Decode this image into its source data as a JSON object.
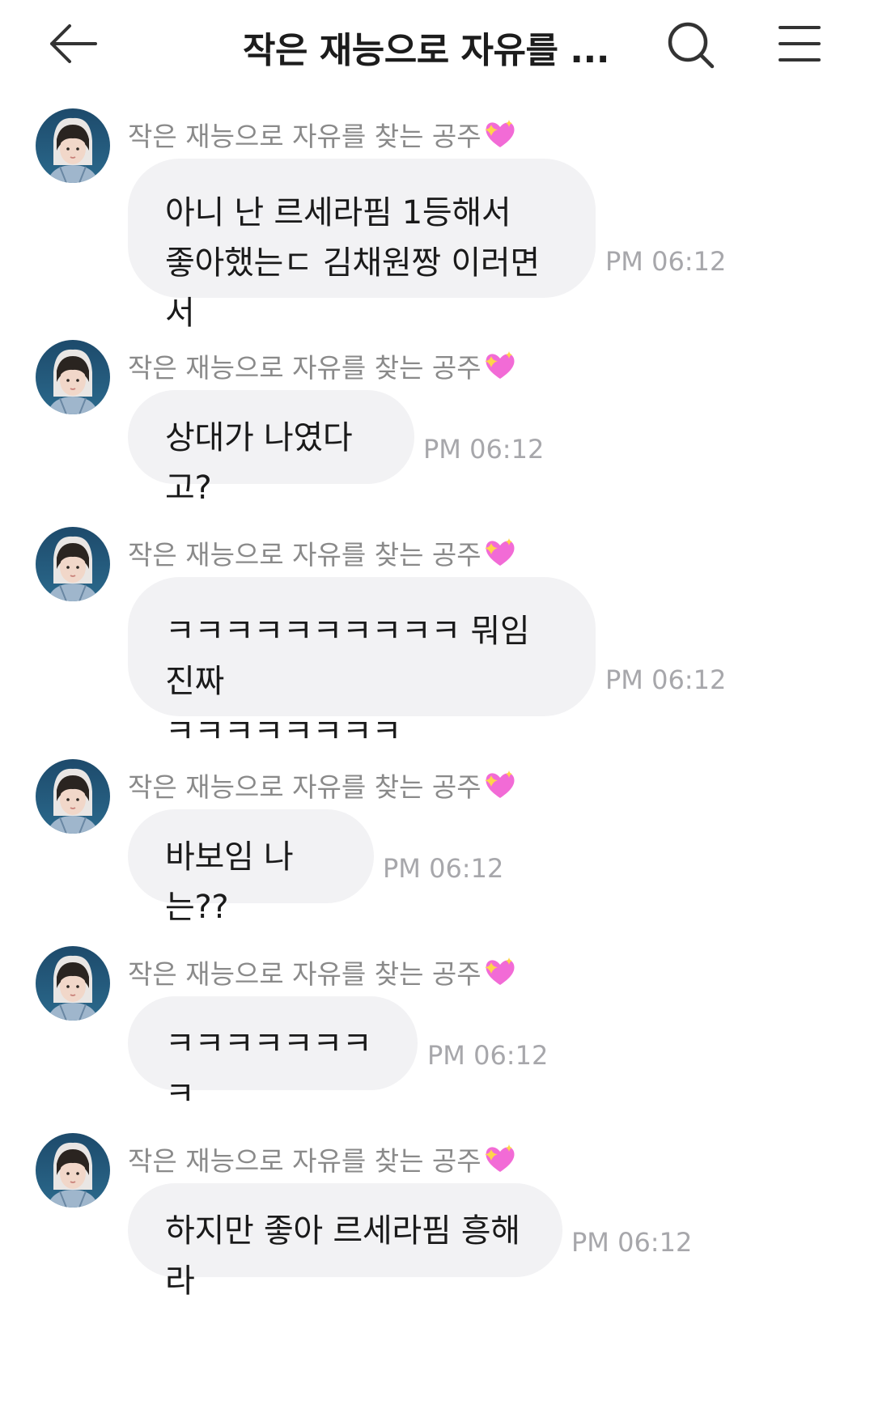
{
  "header": {
    "title": "작은 재능으로 자유를 ...",
    "back_icon": "back-arrow-icon",
    "search_icon": "search-icon",
    "menu_icon": "menu-icon"
  },
  "messages": [
    {
      "sender": "작은 재능으로 자유를 찾는 공주",
      "text": "아니 난 르세라핌 1등해서\n좋아했는ㄷ 김채원짱 이러면서",
      "time": "PM 06:12"
    },
    {
      "sender": "작은 재능으로 자유를 찾는 공주",
      "text": "상대가 나였다고?",
      "time": "PM 06:12"
    },
    {
      "sender": "작은 재능으로 자유를 찾는 공주",
      "text": "ㅋㅋㅋㅋㅋㅋㅋㅋㅋㅋ 뭐임진짜\nㅋㅋㅋㅋㅋㅋㅋㅋ",
      "time": "PM 06:12"
    },
    {
      "sender": "작은 재능으로 자유를 찾는 공주",
      "text": "바보임 나는??",
      "time": "PM 06:12"
    },
    {
      "sender": "작은 재능으로 자유를 찾는 공주",
      "text": "ㅋㅋㅋㅋㅋㅋㅋㅋ",
      "time": "PM 06:12"
    },
    {
      "sender": "작은 재능으로 자유를 찾는 공주",
      "text": "하지만 좋아 르세라핌 흥해라",
      "time": "PM 06:12"
    }
  ],
  "colors": {
    "bubble": "#f2f2f4",
    "sender": "#8a8a8a",
    "time": "#a7a7ab",
    "heart": "#f26bd6"
  }
}
